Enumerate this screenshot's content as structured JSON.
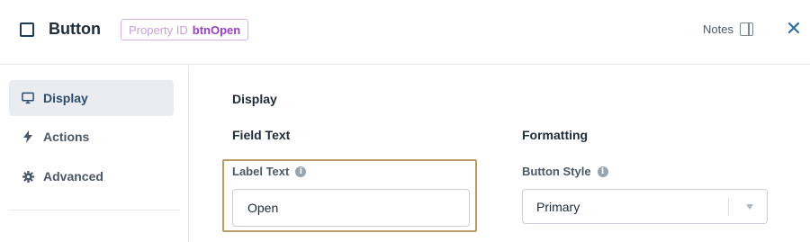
{
  "header": {
    "title": "Button",
    "property_id_label": "Property ID",
    "property_id_value": "btnOpen",
    "notes_label": "Notes",
    "close_icon": "close-icon"
  },
  "sidebar": {
    "items": [
      {
        "label": "Display",
        "icon": "monitor-icon",
        "active": true
      },
      {
        "label": "Actions",
        "icon": "bolt-icon",
        "active": false
      },
      {
        "label": "Advanced",
        "icon": "gear-icon",
        "active": false
      }
    ]
  },
  "main": {
    "section_title": "Display",
    "field_text": {
      "title": "Field Text",
      "label_text_label": "Label Text",
      "label_text_value": "Open"
    },
    "formatting": {
      "title": "Formatting",
      "button_style_label": "Button Style",
      "button_style_value": "Primary"
    }
  },
  "colors": {
    "accent": "#2f6fa6",
    "property_id": "#9b3fc0",
    "highlight_border": "#b89c6a"
  }
}
